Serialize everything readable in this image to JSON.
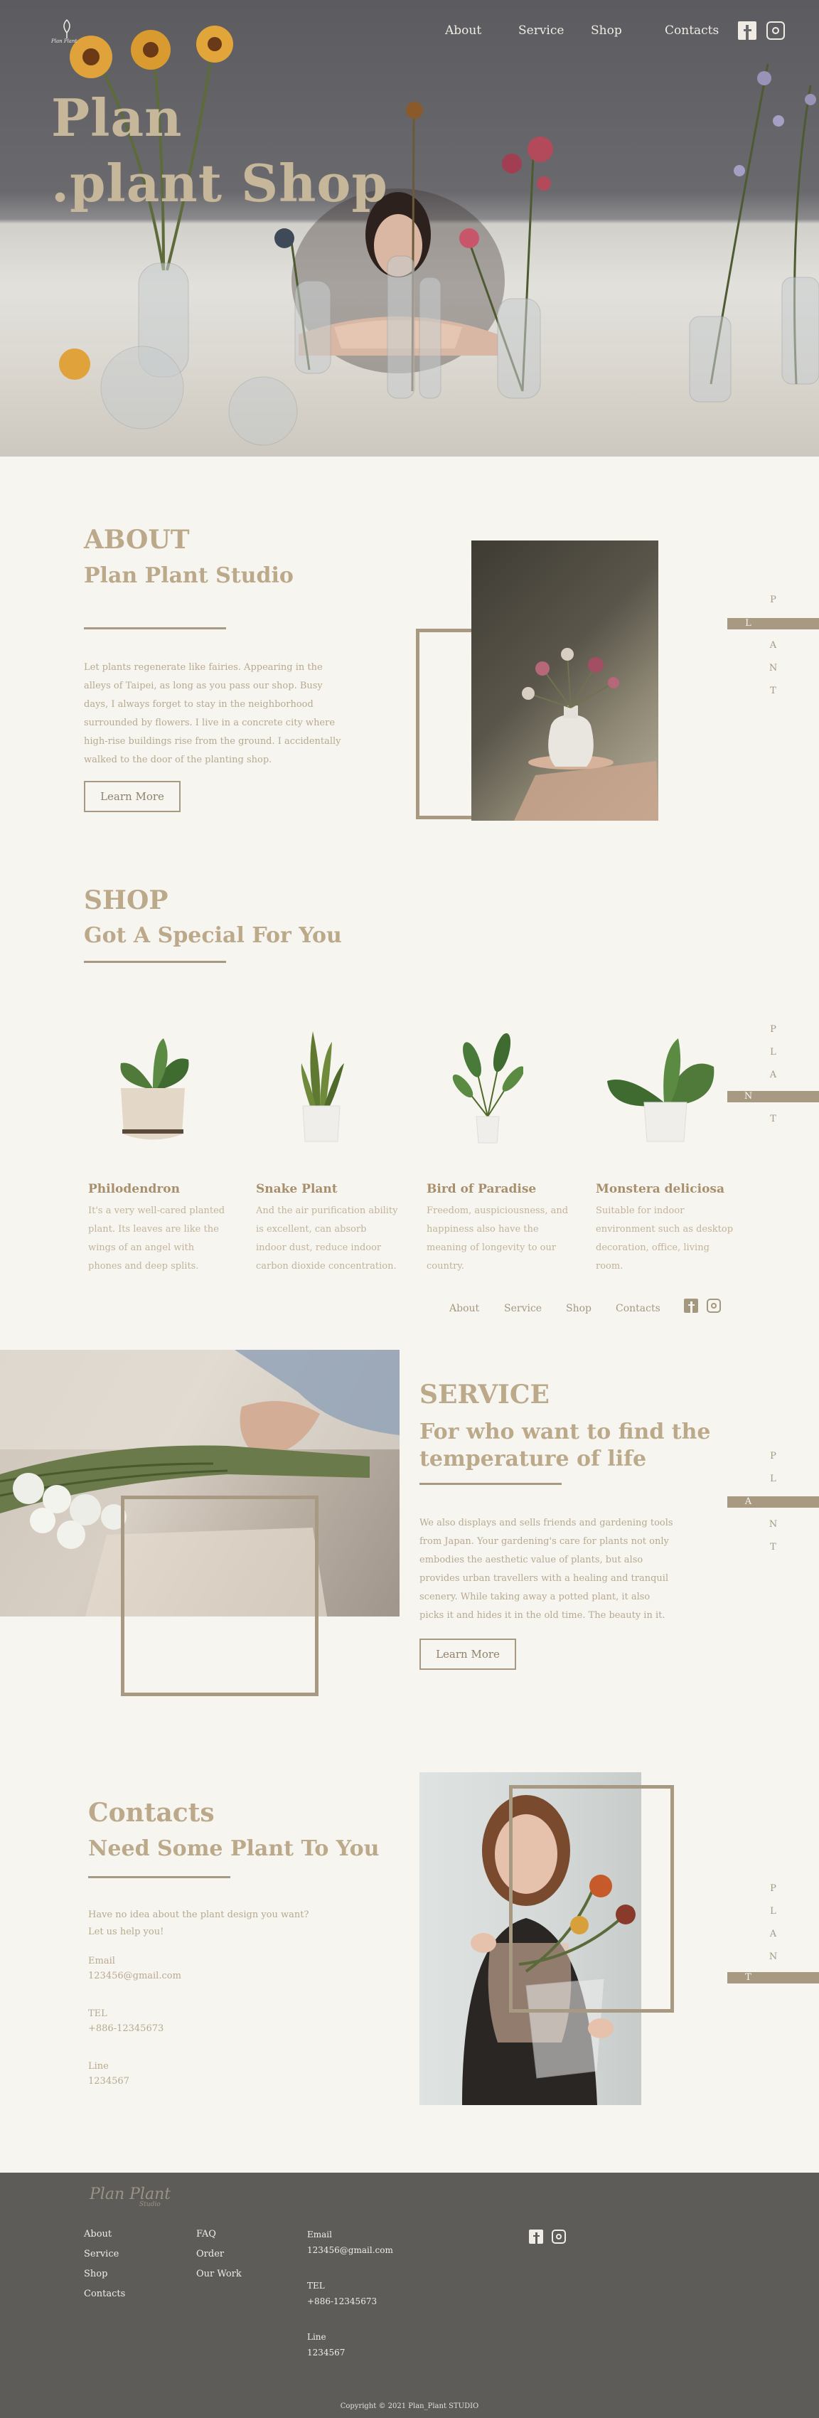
{
  "nav": {
    "logo_text": "Plan Plant",
    "links": [
      "About",
      "Service",
      "Shop",
      "Contacts"
    ],
    "social_icons": [
      "facebook-icon",
      "instagram-icon"
    ]
  },
  "hero": {
    "title_line1": "Plan",
    "title_line2": ".plant Shop"
  },
  "side_letters": [
    "P",
    "L",
    "A",
    "N",
    "T"
  ],
  "about": {
    "title": "ABOUT",
    "subtitle": "Plan Plant Studio",
    "paragraph": "Let plants regenerate like fairies. Appearing in the alleys of Taipei, as long as you pass our shop. Busy days, I always forget to stay in the neighborhood surrounded by flowers. I live in a concrete city where high-rise buildings rise from the ground. I accidentally walked to the door of the planting shop.",
    "button": "Learn More"
  },
  "shop": {
    "title": "SHOP",
    "subtitle": "Got A Special For You",
    "products": [
      {
        "name": "Philodendron",
        "desc": "It's a very well-cared planted plant. Its leaves are like the wings of an angel with phones and deep splits."
      },
      {
        "name": "Snake Plant",
        "desc": "And the air purification ability is excellent, can absorb indoor dust, reduce indoor carbon dioxide concentration."
      },
      {
        "name": "Bird of Paradise",
        "desc": "Freedom, auspiciousness, and happiness also have the meaning of longevity to our country."
      },
      {
        "name": "Monstera deliciosa",
        "desc": "Suitable for indoor environment such as desktop decoration, office, living room."
      }
    ],
    "mini_nav": [
      "About",
      "Service",
      "Shop",
      "Contacts"
    ]
  },
  "service": {
    "title": "SERVICE",
    "subtitle_line1": "For who want to find the",
    "subtitle_line2": "temperature of life",
    "paragraph": "We also displays and sells friends and gardening tools from Japan. Your gardening's care for plants not only embodies the aesthetic value of plants, but also provides urban travellers with a healing and tranquil scenery. While taking away a potted plant, it also picks it and hides it in the old time. The beauty in it.",
    "button": "Learn More"
  },
  "contacts": {
    "title": "Contacts",
    "subtitle": "Need Some Plant To You",
    "intro_line1": "Have no idea about the plant design you want?",
    "intro_line2": "Let us help you!",
    "email_label": "Email",
    "email_value": "123456@gmail.com",
    "tel_label": "TEL",
    "tel_value": "+886-12345673",
    "line_label": "Line",
    "line_value": "1234567"
  },
  "footer": {
    "logo_text": "Plan Plant",
    "logo_sub": "Studio",
    "col1": [
      "About",
      "Service",
      "Shop",
      "Contacts"
    ],
    "col2": [
      "FAQ",
      "Order",
      "Our Work"
    ],
    "email_label": "Email",
    "email_value": "123456@gmail.com",
    "tel_label": "TEL",
    "tel_value": "+886-12345673",
    "line_label": "Line",
    "line_value": "1234567",
    "copyright": "Copyright © 2021 Plan_Plant STUDIO"
  },
  "colors": {
    "accent": "#a89a82",
    "background": "#f7f5f0",
    "footer_bg": "#5d5c58"
  }
}
